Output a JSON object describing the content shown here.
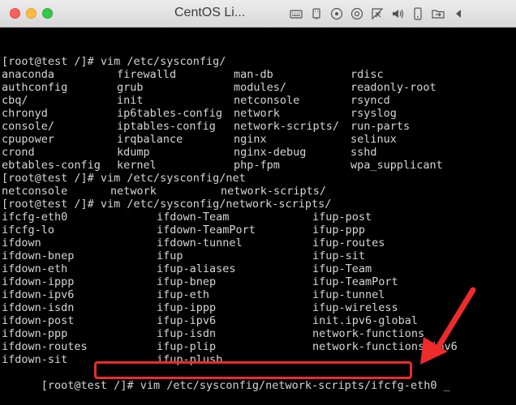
{
  "window": {
    "title": "CentOS Li..."
  },
  "toolbar": {
    "icons": [
      "keyboard-icon",
      "usb-icon",
      "disc-icon",
      "disc-2-icon",
      "network-icon",
      "sound-icon",
      "device-icon",
      "shared-folder-icon",
      "chevron-left-icon"
    ]
  },
  "terminal": {
    "prompt1": "[root@test /]# vim /etc/sysconfig/",
    "sysconfig_listing": [
      [
        "anaconda",
        "firewalld",
        "man-db",
        "rdisc"
      ],
      [
        "authconfig",
        "grub",
        "modules/",
        "readonly-root"
      ],
      [
        "cbq/",
        "init",
        "netconsole",
        "rsyncd"
      ],
      [
        "chronyd",
        "ip6tables-config",
        "network",
        "rsyslog"
      ],
      [
        "console/",
        "iptables-config",
        "network-scripts/",
        "run-parts"
      ],
      [
        "cpupower",
        "irqbalance",
        "nginx",
        "selinux"
      ],
      [
        "crond",
        "kdump",
        "nginx-debug",
        "sshd"
      ],
      [
        "ebtables-config",
        "kernel",
        "php-fpm",
        "wpa_supplicant"
      ]
    ],
    "prompt2": "[root@test /]# vim /etc/sysconfig/net",
    "net_listing": [
      "netconsole",
      "network",
      "network-scripts/"
    ],
    "prompt3": "[root@test /]# vim /etc/sysconfig/network-scripts/",
    "scripts_listing": [
      [
        "ifcfg-eth0",
        "ifdown-Team",
        "ifup-post"
      ],
      [
        "ifcfg-lo",
        "ifdown-TeamPort",
        "ifup-ppp"
      ],
      [
        "ifdown",
        "ifdown-tunnel",
        "ifup-routes"
      ],
      [
        "ifdown-bnep",
        "ifup",
        "ifup-sit"
      ],
      [
        "ifdown-eth",
        "ifup-aliases",
        "ifup-Team"
      ],
      [
        "ifdown-ippp",
        "ifup-bnep",
        "ifup-TeamPort"
      ],
      [
        "ifdown-ipv6",
        "ifup-eth",
        "ifup-tunnel"
      ],
      [
        "ifdown-isdn",
        "ifup-ippp",
        "ifup-wireless"
      ],
      [
        "ifdown-post",
        "ifup-ipv6",
        "init.ipv6-global"
      ],
      [
        "ifdown-ppp",
        "ifup-isdn",
        "network-functions"
      ],
      [
        "ifdown-routes",
        "ifup-plip",
        "network-functions-ipv6"
      ],
      [
        "ifdown-sit",
        "ifup-plusb",
        ""
      ]
    ],
    "final_prompt": "[root@test /]# ",
    "final_command": "vim /etc/sysconfig/network-scripts/ifcfg-eth0",
    "cursor": "_"
  },
  "colors": {
    "terminal_bg": "#000000",
    "terminal_fg": "#d6d6d6",
    "highlight": "#ee2b2b"
  }
}
